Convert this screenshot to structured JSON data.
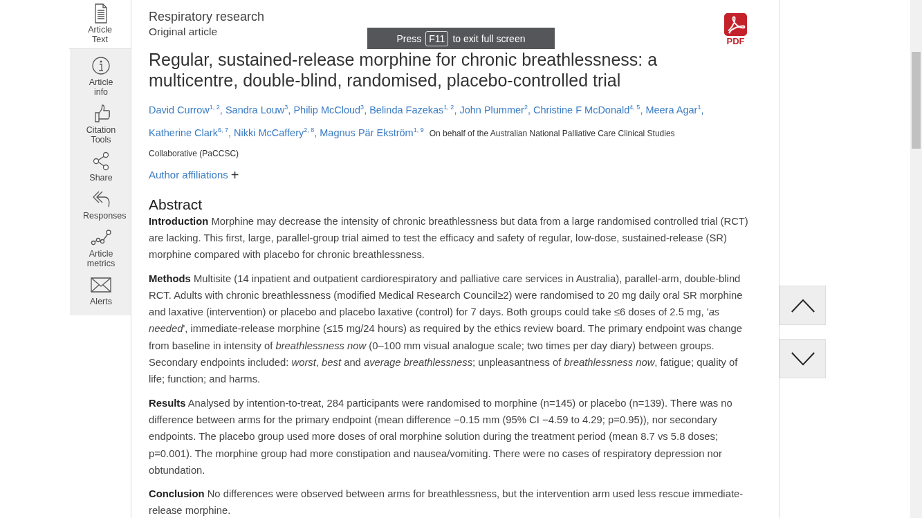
{
  "sidebar": {
    "items": [
      {
        "label": "Article Text",
        "selected": true
      },
      {
        "label": "Article info",
        "selected": false
      },
      {
        "label": "Citation Tools",
        "selected": false
      },
      {
        "label": "Share",
        "selected": false
      },
      {
        "label": "Responses",
        "selected": false
      },
      {
        "label": "Article metrics",
        "selected": false
      },
      {
        "label": "Alerts",
        "selected": false
      }
    ]
  },
  "article": {
    "section": "Respiratory research",
    "type": "Original article",
    "pdf_label": "PDF",
    "title": "Regular, sustained-release morphine for chronic breathlessness: a multicentre, double-blind, randomised, placebo-controlled trial",
    "authors": [
      "David Currow$^{1, 2}$,",
      "Sandra Louw$^{3}$,",
      "Philip McCloud$^{3}$,",
      "Belinda Fazekas$^{1, 2}$,",
      "John Plummer$^{2}$,",
      "Christine F McDonald$^{4, 5}$,",
      "Meera Agar$^{1}$,",
      "Katherine Clark$^{6, 7}$,",
      "Nikki McCaffery$^{2, 8}$,",
      "Magnus Pär Ekström$^{1, 9}$"
    ],
    "group_lines": [
      "On behalf of the Australian National Palliative Care Clinical Studies",
      "Collaborative (PaCCSC)"
    ],
    "affiliations_link": "Author affiliations",
    "affiliations_toggle": "+",
    "abstract_heading": "Abstract",
    "abstract": [
      "**Introduction** Morphine may decrease the intensity of chronic breathlessness but data from a large randomised controlled trial (RCT) are lacking. This first, large, parallel-group trial aimed to test the efficacy and safety of regular, low-dose, sustained-release (SR) morphine compared with placebo for chronic breathlessness.",
      "**Methods** Multisite (14 inpatient and outpatient cardiorespiratory and palliative care services in Australia), parallel-arm, double-blind RCT. Adults with chronic breathlessness (modified Medical Research Council≥2) were randomised to 20 mg daily oral SR morphine and laxative (intervention) or placebo and placebo laxative (control) for 7 days. Both groups could take ≤6 doses of 2.5 mg, '*as needed*', immediate-release morphine (≤15 mg/24 hours) as required by the ethics review board. The primary endpoint was change from baseline in intensity of *breathlessness now* (0–100 mm visual analogue scale; two times per day diary) between groups. Secondary endpoints included: *worst*, *best* and *average breathlessness*; unpleasantness of *breathlessness now*, fatigue; quality of life; function; and harms.",
      "**Results** Analysed by intention-to-treat, 284 participants were randomised to morphine (n=145) or placebo (n=139). There was no difference between arms for the primary endpoint (mean difference −0.15 mm (95% CI −4.59 to 4.29; p=0.95)), nor secondary endpoints. The placebo group used more doses of oral morphine solution during the treatment period (mean 8.7 vs 5.8 doses; p=0.001). The morphine group had more constipation and nausea/vomiting. There were no cases of respiratory depression nor obtundation.",
      "**Conclusion** No differences were observed between arms for breathlessness, but the intervention arm used less rescue immediate-release morphine."
    ]
  },
  "fullscreen_notice": {
    "before": "Press",
    "key": "F11",
    "after": "to exit full screen"
  }
}
